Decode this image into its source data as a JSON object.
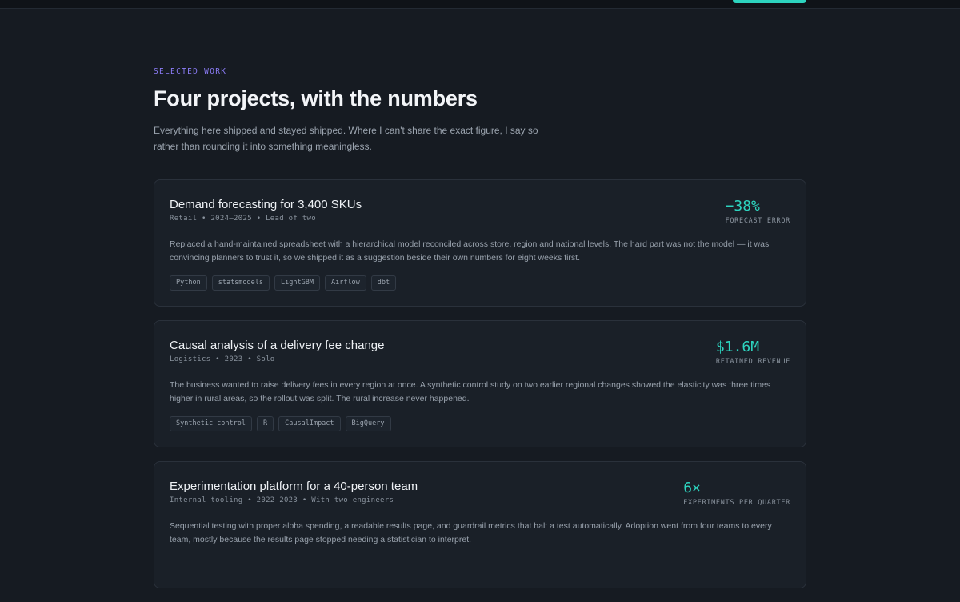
{
  "section": {
    "eyebrow": "SELECTED WORK",
    "title": "Four projects, with the numbers",
    "lede": "Everything here shipped and stayed shipped. Where I can't share the exact figure, I say so rather than rounding it into something meaningless."
  },
  "projects": [
    {
      "title": "Demand forecasting for 3,400 SKUs",
      "meta": "Retail • 2024–2025 • Lead of two",
      "description": "Replaced a hand-maintained spreadsheet with a hierarchical model reconciled across store, region and national levels. The hard part was not the model — it was convincing planners to trust it, so we shipped it as a suggestion beside their own numbers for eight weeks first.",
      "metric_value": "−38%",
      "metric_label": "FORECAST ERROR",
      "tags": [
        "Python",
        "statsmodels",
        "LightGBM",
        "Airflow",
        "dbt"
      ]
    },
    {
      "title": "Causal analysis of a delivery fee change",
      "meta": "Logistics • 2023 • Solo",
      "description": "The business wanted to raise delivery fees in every region at once. A synthetic control study on two earlier regional changes showed the elasticity was three times higher in rural areas, so the rollout was split. The rural increase never happened.",
      "metric_value": "$1.6M",
      "metric_label": "RETAINED REVENUE",
      "tags": [
        "Synthetic control",
        "R",
        "CausalImpact",
        "BigQuery"
      ]
    },
    {
      "title": "Experimentation platform for a 40-person team",
      "meta": "Internal tooling • 2022–2023 • With two engineers",
      "description": "Sequential testing with proper alpha spending, a readable results page, and guardrail metrics that halt a test automatically. Adoption went from four teams to every team, mostly because the results page stopped needing a statistician to interpret.",
      "metric_value": "6×",
      "metric_label": "EXPERIMENTS PER QUARTER",
      "tags": []
    }
  ],
  "colors": {
    "accent": "#2dd4bf",
    "eyebrow": "#8b7cf6",
    "background": "#161b22",
    "card": "#1a2028"
  }
}
